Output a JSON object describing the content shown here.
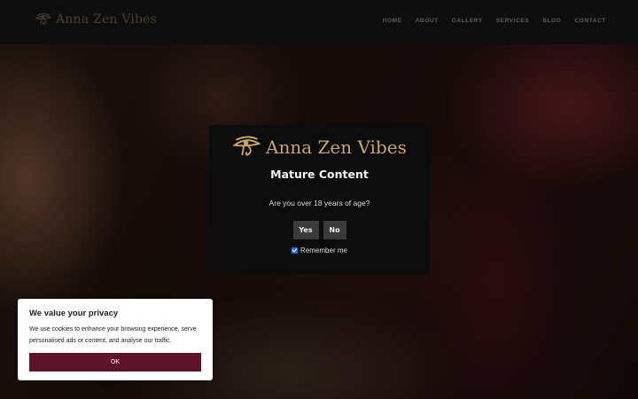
{
  "site": {
    "brand_name": "Anna Zen Vibes",
    "logo_icon": "eye-of-horus-icon",
    "brand_color": "#c8a66c"
  },
  "nav": {
    "items": [
      "HOME",
      "ABOUT",
      "GALLERY",
      "SERVICES",
      "BLOG",
      "CONTACT"
    ]
  },
  "age_gate": {
    "title": "Mature Content",
    "question": "Are you over 18 years of age?",
    "yes_label": "Yes",
    "no_label": "No",
    "remember_label": "Remember me",
    "remember_checked": true
  },
  "cookie_banner": {
    "title": "We value your privacy",
    "body": "We use cookies to enhance your browsing experience, serve personalised ads or content, and analyse our traffic.",
    "ok_label": "OK",
    "button_color": "#5e1428"
  }
}
